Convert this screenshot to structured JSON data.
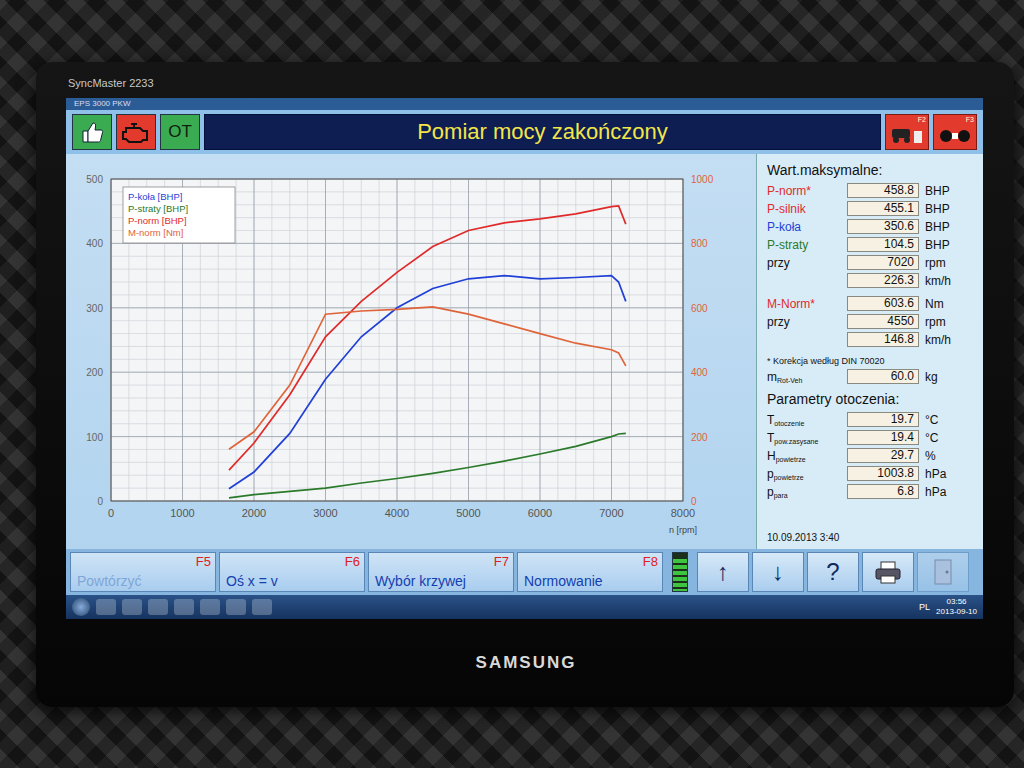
{
  "monitor": {
    "model": "SyncMaster 2233",
    "brand": "SAMSUNG"
  },
  "app": {
    "title": "EPS 3000 PKW"
  },
  "toolbar": {
    "status_icons": [
      {
        "kind": "thumbs",
        "label": "",
        "color": "#3bab52"
      },
      {
        "kind": "engine",
        "label": "",
        "color": "#e23b2e"
      },
      {
        "kind": "text",
        "label": "OT",
        "color": "#3bab52"
      }
    ],
    "title": "Pomiar mocy zakończony",
    "right_buttons": [
      {
        "kind": "dyno",
        "key": "F2"
      },
      {
        "kind": "rollers",
        "key": "F3"
      }
    ]
  },
  "chart": {
    "left_ticks": [
      "0",
      "100",
      "200",
      "300",
      "400",
      "500"
    ],
    "right_ticks": [
      "0",
      "200",
      "400",
      "600",
      "800",
      "1000"
    ],
    "x_ticks": [
      "0",
      "1000",
      "2000",
      "3000",
      "4000",
      "5000",
      "6000",
      "7000",
      "8000"
    ],
    "x_label": "n [rpm]",
    "rpm": [
      1650,
      2000,
      2500,
      3000,
      3500,
      4000,
      4500,
      5000,
      5500,
      6000,
      6500,
      7000,
      7100,
      7200
    ],
    "series": [
      {
        "name": "P-koła [BHP]",
        "axis": "left",
        "color": "#1f3fd6",
        "values": [
          19,
          45,
          105,
          189,
          255,
          300,
          330,
          345,
          350,
          345,
          347,
          350,
          340,
          310
        ]
      },
      {
        "name": "P-straty [BHP]",
        "axis": "left",
        "color": "#2a7a2a",
        "values": [
          5,
          10,
          15,
          20,
          28,
          35,
          43,
          52,
          62,
          73,
          85,
          100,
          104,
          105
        ]
      },
      {
        "name": "P-norm [BHP]",
        "axis": "left",
        "color": "#e02a2a",
        "values": [
          48,
          90,
          165,
          255,
          310,
          355,
          395,
          420,
          432,
          438,
          446,
          457,
          458,
          430
        ]
      },
      {
        "name": "M-norm [Nm]",
        "axis": "right",
        "color": "#e0643a",
        "values": [
          161,
          215,
          360,
          580,
          590,
          595,
          603,
          580,
          550,
          520,
          490,
          470,
          460,
          420
        ]
      }
    ]
  },
  "max_values": {
    "title": "Wart.maksymalne:",
    "power_rows": [
      {
        "label": "P-norm*",
        "sub": "",
        "value": "458.8",
        "unit": "BHP",
        "color": "#e02a2a"
      },
      {
        "label": "P-silnik",
        "sub": "",
        "value": "455.1",
        "unit": "BHP",
        "color": "#e02a2a"
      },
      {
        "label": "P-koła",
        "sub": "",
        "value": "350.6",
        "unit": "BHP",
        "color": "#1f3fd6"
      },
      {
        "label": "P-straty",
        "sub": "",
        "value": "104.5",
        "unit": "BHP",
        "color": "#2a7a2a"
      },
      {
        "label": "przy",
        "sub": "",
        "value": "7020",
        "unit": "rpm",
        "color": "#111111"
      },
      {
        "label": "",
        "sub": "",
        "value": "226.3",
        "unit": "km/h",
        "color": "#111111"
      }
    ],
    "torque_rows": [
      {
        "label": "M-Norm*",
        "sub": "",
        "value": "603.6",
        "unit": "Nm",
        "color": "#e02a2a"
      },
      {
        "label": "przy",
        "sub": "",
        "value": "4550",
        "unit": "rpm",
        "color": "#111111"
      },
      {
        "label": "",
        "sub": "",
        "value": "146.8",
        "unit": "km/h",
        "color": "#111111"
      }
    ],
    "note": "* Korekcja według DIN 70020",
    "mass": {
      "label": "m",
      "sub": "Rot-Veh",
      "value": "60.0",
      "unit": "kg"
    }
  },
  "ambient": {
    "title": "Parametry otoczenia:",
    "rows": [
      {
        "label": "T",
        "sub": "otoczenie",
        "value": "19.7",
        "unit": "°C"
      },
      {
        "label": "T",
        "sub": "pow.zasysane",
        "value": "19.4",
        "unit": "°C"
      },
      {
        "label": "H",
        "sub": "powietrze",
        "value": "29.7",
        "unit": "%"
      },
      {
        "label": "p",
        "sub": "powietrze",
        "value": "1003.8",
        "unit": "hPa"
      },
      {
        "label": "p",
        "sub": "para",
        "value": "6.8",
        "unit": "hPa"
      }
    ]
  },
  "date": "10.09.2013 3:40",
  "function_keys": [
    {
      "label": "Powtórzyć",
      "key": "F5",
      "disabled": true
    },
    {
      "label": "Oś x = v",
      "key": "F6",
      "disabled": false
    },
    {
      "label": "Wybór krzywej",
      "key": "F7",
      "disabled": false
    },
    {
      "label": "Normowanie",
      "key": "F8",
      "disabled": false
    }
  ],
  "meter": {
    "level": 0.85
  },
  "nav_buttons": [
    {
      "kind": "text",
      "label": "↑",
      "disabled": false
    },
    {
      "kind": "text",
      "label": "↓",
      "disabled": false
    },
    {
      "kind": "text",
      "label": "?",
      "disabled": false
    },
    {
      "kind": "printer",
      "label": "",
      "disabled": false
    },
    {
      "kind": "exit",
      "label": "",
      "disabled": true
    }
  ],
  "taskbar": {
    "language": "PL",
    "time": "03:56",
    "date": "2013-09-10"
  }
}
